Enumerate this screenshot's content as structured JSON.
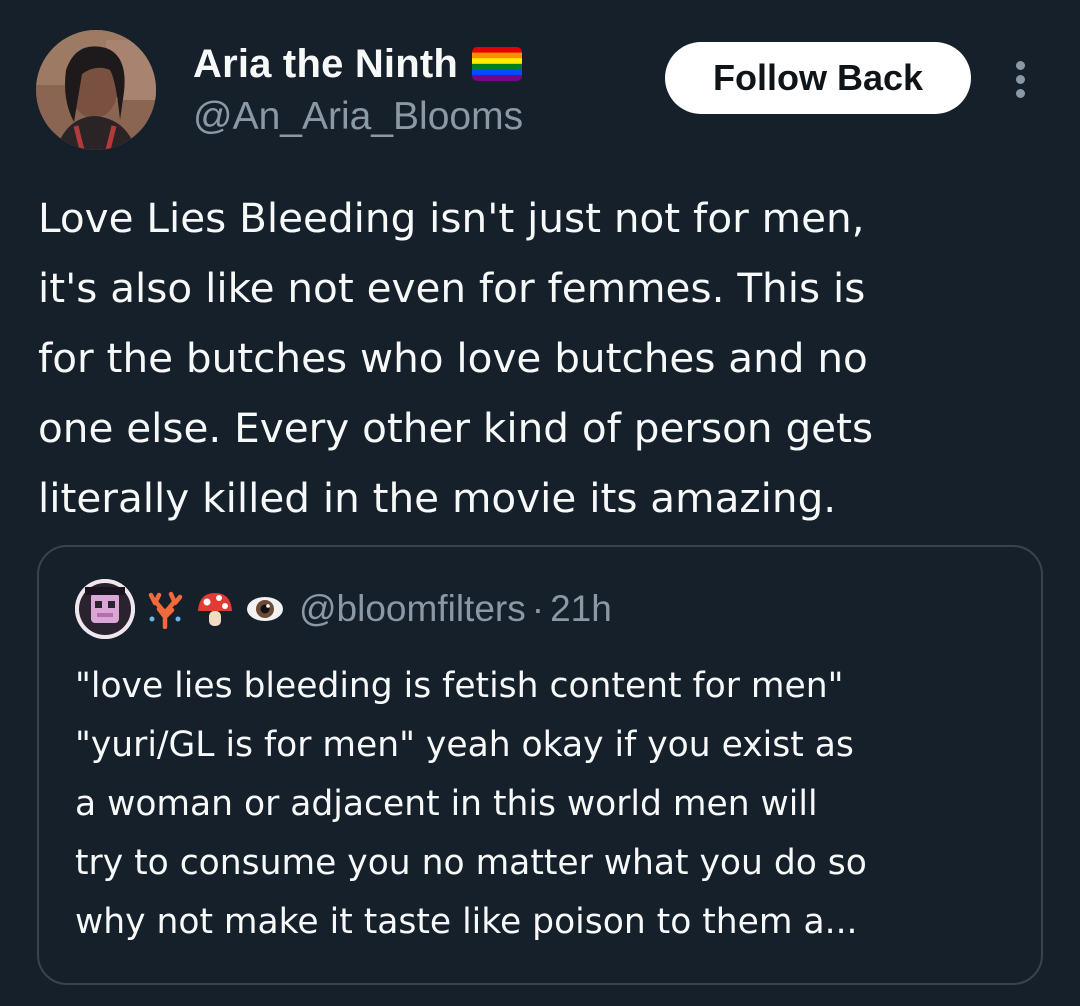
{
  "author": {
    "display_name": "Aria the Ninth",
    "flag_icon": "rainbow-pride-flag-icon",
    "handle": "@An_Aria_Blooms"
  },
  "actions": {
    "follow_label": "Follow Back",
    "more_icon": "more-vertical-icon"
  },
  "tweet": {
    "lines": [
      "Love Lies Bleeding isn't just not for men,",
      "it's also like not even for femmes. This is",
      "for the butches who love butches and no",
      "one else. Every other kind of person gets",
      "literally killed in the movie its amazing."
    ]
  },
  "quote": {
    "emojis": [
      "coral-emoji-icon",
      "mushroom-emoji-icon",
      "eye-emoji-icon"
    ],
    "handle": "@bloomfilters",
    "separator": "·",
    "time": "21h",
    "lines": [
      "\"love lies bleeding is fetish content for men\"",
      "\"yuri/GL is for men\" yeah okay if you exist as",
      "a woman or adjacent in this world men will",
      "try to consume you no matter what you do so",
      "why not make it taste like poison to them a..."
    ]
  },
  "colors": {
    "background": "#15202b",
    "text_primary": "#f7f9f9",
    "text_secondary": "#8b98a5",
    "border": "#38444d",
    "button_bg": "#ffffff",
    "button_text": "#0f1419"
  }
}
